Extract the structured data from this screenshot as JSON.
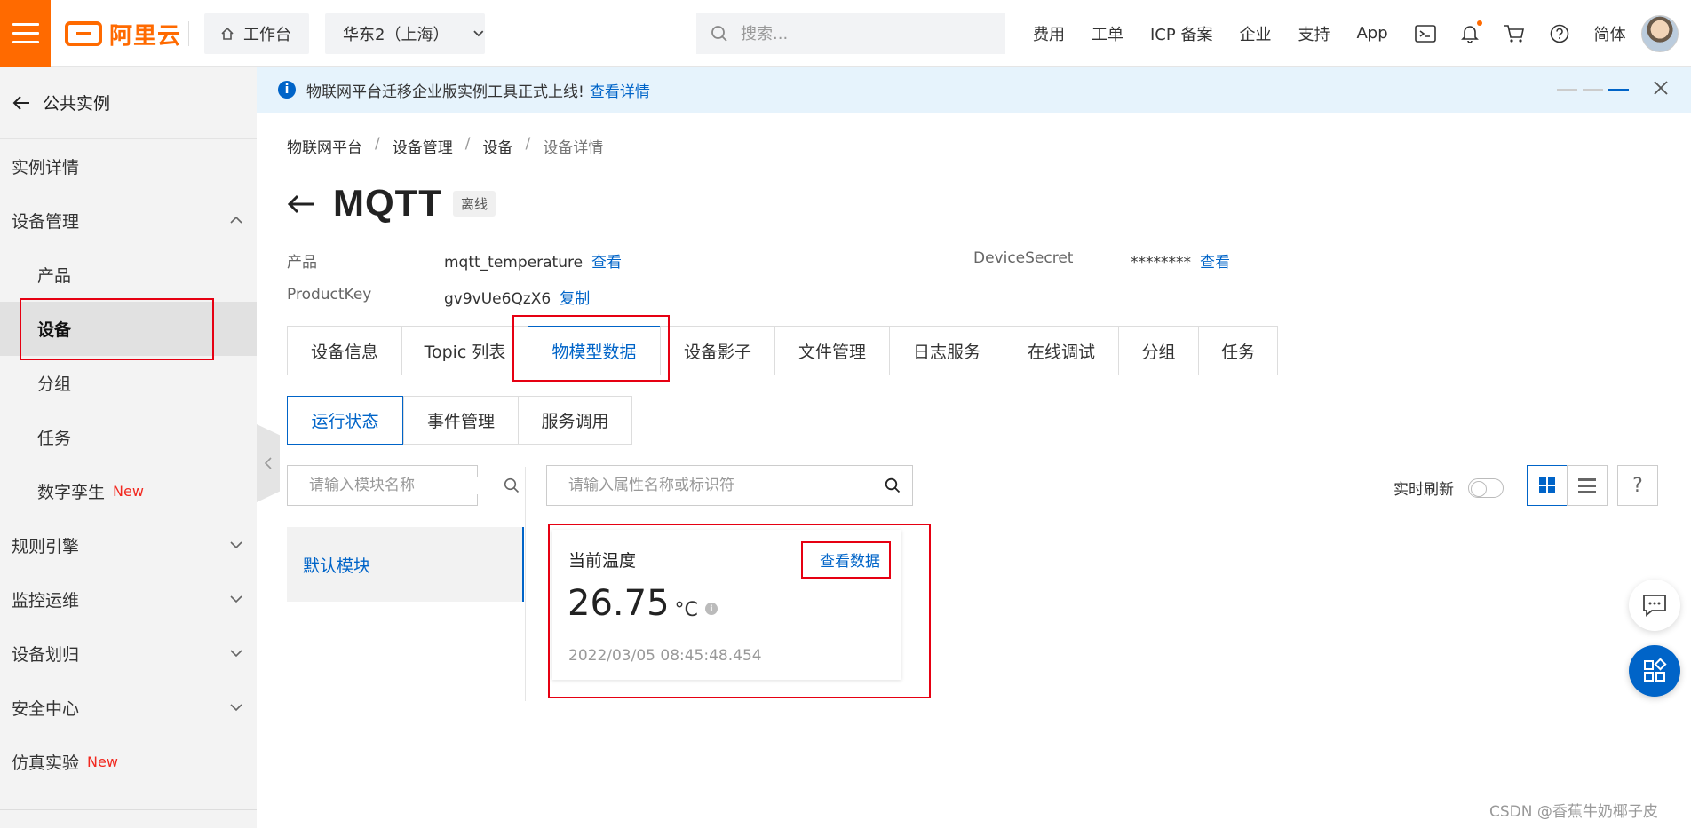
{
  "topbar": {
    "logo_text": "阿里云",
    "workbench": "工作台",
    "region": "华东2（上海）",
    "search_placeholder": "搜索...",
    "nav": [
      "费用",
      "工单",
      "ICP 备案",
      "企业",
      "支持",
      "App"
    ],
    "lang": "简体",
    "icons": [
      "terminal-icon",
      "bell-icon",
      "cart-icon",
      "help-icon"
    ]
  },
  "sidebar": {
    "back_label": "公共实例",
    "items": [
      {
        "label": "实例详情"
      },
      {
        "label": "设备管理",
        "expanded": true
      },
      {
        "label": "产品"
      },
      {
        "label": "设备",
        "active": true
      },
      {
        "label": "分组"
      },
      {
        "label": "任务"
      },
      {
        "label": "数字孪生",
        "tag": "New"
      },
      {
        "label": "规则引擎"
      },
      {
        "label": "监控运维"
      },
      {
        "label": "设备划归"
      },
      {
        "label": "安全中心"
      },
      {
        "label": "仿真实验",
        "tag": "New"
      }
    ]
  },
  "notice": {
    "text": "物联网平台迁移企业版实例工具正式上线!",
    "link": "查看详情"
  },
  "breadcrumb": [
    "物联网平台",
    "设备管理",
    "设备",
    "设备详情"
  ],
  "device": {
    "name": "MQTT",
    "status": "离线",
    "product_label": "产品",
    "product_value": "mqtt_temperature",
    "product_link": "查看",
    "productkey_label": "ProductKey",
    "productkey_value": "gv9vUe6QzX6",
    "productkey_link": "复制",
    "secret_label": "DeviceSecret",
    "secret_value": "********",
    "secret_link": "查看"
  },
  "tabs": [
    "设备信息",
    "Topic 列表",
    "物模型数据",
    "设备影子",
    "文件管理",
    "日志服务",
    "在线调试",
    "分组",
    "任务"
  ],
  "active_tab": "物模型数据",
  "subtabs": [
    "运行状态",
    "事件管理",
    "服务调用"
  ],
  "active_subtab": "运行状态",
  "module_search_placeholder": "请输入模块名称",
  "property_search_placeholder": "请输入属性名称或标识符",
  "modules": [
    "默认模块"
  ],
  "realtime_label": "实时刷新",
  "realtime_on": false,
  "help_label": "?",
  "property_card": {
    "name": "当前温度",
    "link": "查看数据",
    "value": "26.75",
    "unit": "°C",
    "time": "2022/03/05 08:45:48.454"
  },
  "watermark": "CSDN @香蕉牛奶椰子皮",
  "colors": {
    "brand": "#ff6a00",
    "primary": "#0064c8",
    "highlight": "#e60012",
    "new_tag": "#f2281f"
  }
}
